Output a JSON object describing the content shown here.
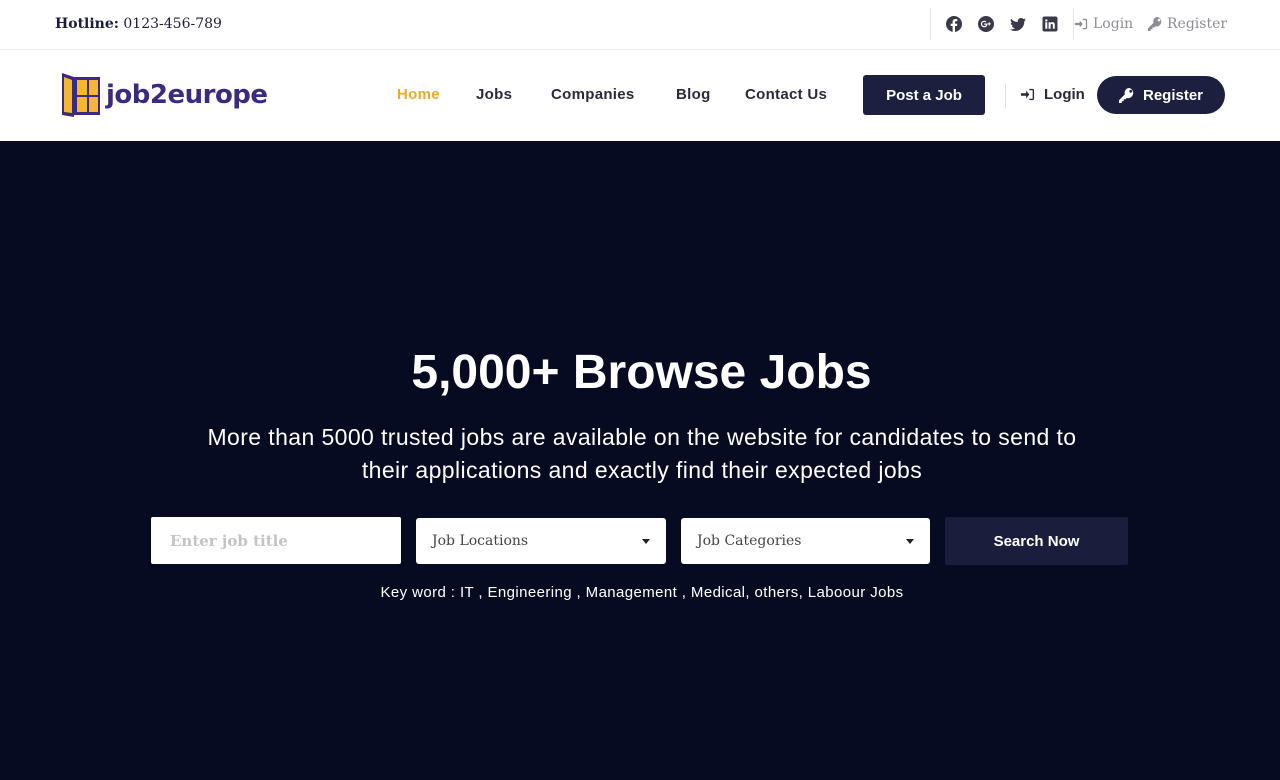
{
  "topbar": {
    "hotline_label": "Hotline:",
    "hotline_number": "0123-456-789",
    "social_icons": [
      "facebook-icon",
      "google-plus-icon",
      "twitter-icon",
      "linkedin-icon"
    ],
    "login_label": "Login",
    "register_label": "Register"
  },
  "header": {
    "logo_text": "job2europe",
    "nav": {
      "home": "Home",
      "jobs": "Jobs",
      "companies": "Companies",
      "blog": "Blog",
      "contact": "Contact Us"
    },
    "post_job_label": "Post a Job",
    "login_label": "Login",
    "register_label": "Register"
  },
  "hero": {
    "title": "5,000+ Browse Jobs",
    "subtitle_line1": "More than 5000 trusted jobs are available on the website for candidates to send to",
    "subtitle_line2": "their applications and exactly find their expected jobs",
    "search": {
      "job_title_placeholder": "Enter job title",
      "location_selected": "Job Locations",
      "category_selected": "Job Categories",
      "button_label": "Search Now"
    },
    "keywords": "Key word : IT , Engineering , Management , Medical, others, Laboour Jobs"
  },
  "colors": {
    "accent": "#e8ac2b",
    "navy": "#1d1f3e",
    "hero_bg": "#070b21",
    "logo_purple": "#3c2a7e",
    "logo_yellow": "#f5b731"
  }
}
